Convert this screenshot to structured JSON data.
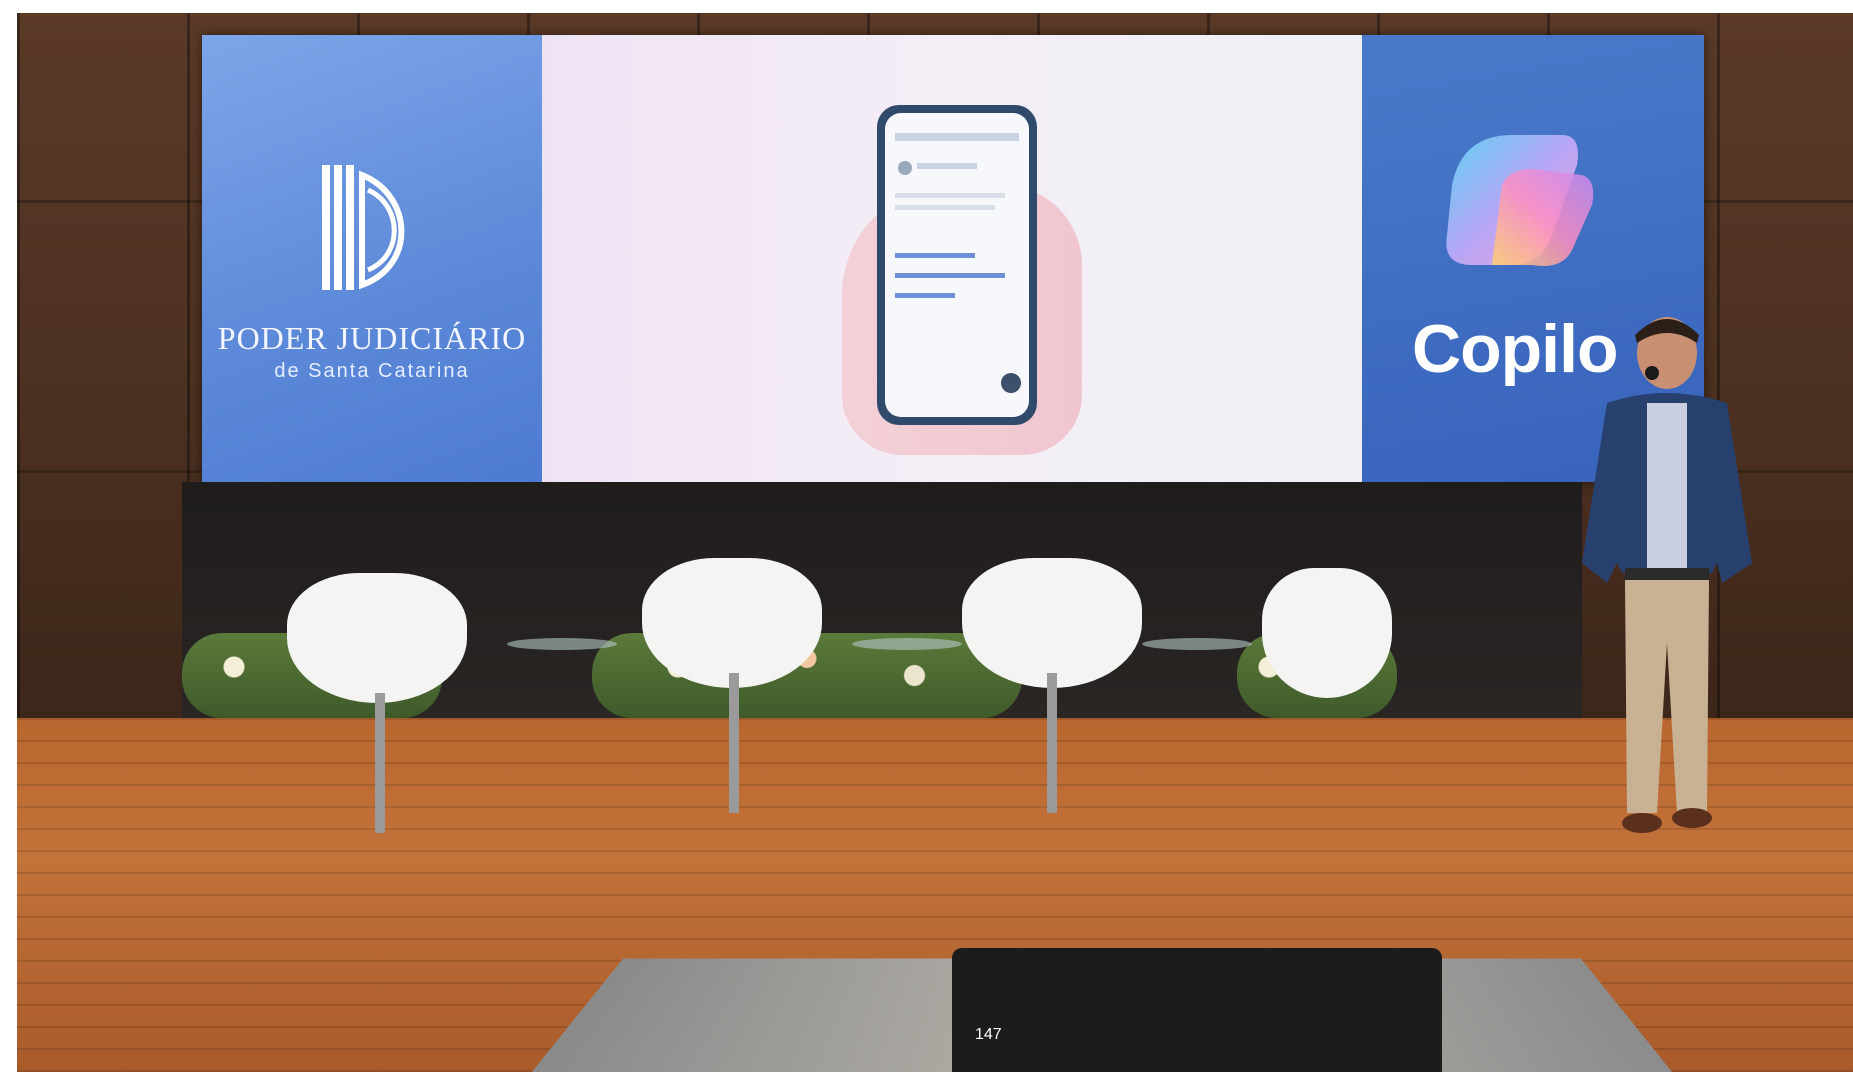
{
  "screen": {
    "left_panel": {
      "title": "PODER JUDICIÁRIO",
      "subtitle": "de Santa Catarina"
    },
    "right_panel": {
      "product_name": "Copilo"
    }
  },
  "page_number": "147",
  "colors": {
    "left_panel": "#5b88d8",
    "right_panel": "#3e6cc1",
    "floor": "#c2733a",
    "wall": "#4a2f20"
  }
}
